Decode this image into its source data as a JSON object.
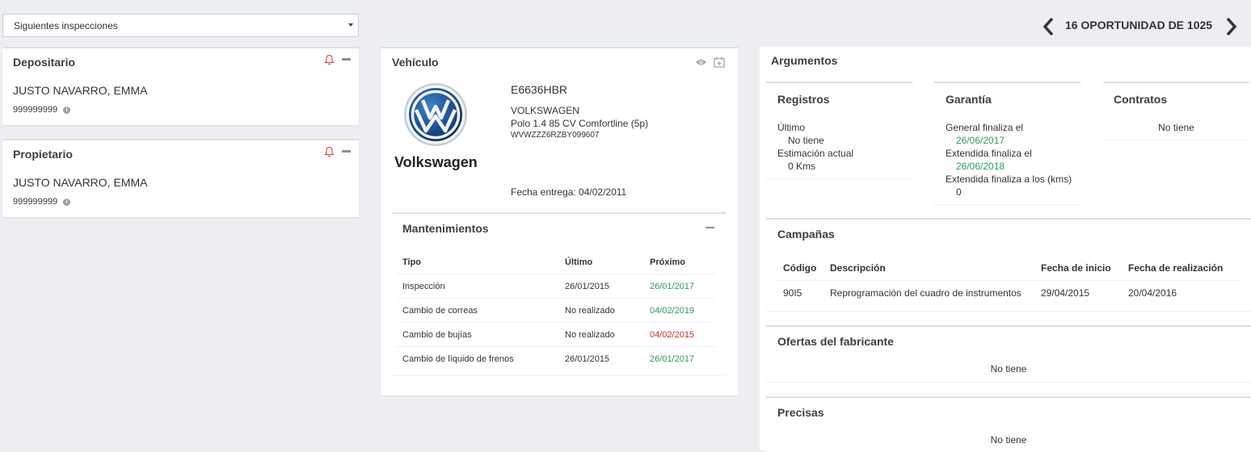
{
  "filter": {
    "selected": "Siguientes inspecciones"
  },
  "nav": {
    "counter": "16 OPORTUNIDAD DE 1025"
  },
  "depositario": {
    "title": "Depositario",
    "name": "JUSTO NAVARRO, EMMA",
    "phone": "999999999"
  },
  "propietario": {
    "title": "Propietario",
    "name": "JUSTO NAVARRO, EMMA",
    "phone": "999999999"
  },
  "vehiculo": {
    "title": "Vehículo",
    "brand_name": "Volkswagen",
    "plate": "E6636HBR",
    "make": "VOLKSWAGEN",
    "model": "Polo 1.4 85 CV Comfortline (5p)",
    "vin": "WVWZZZ6RZBY099607",
    "delivery": "Fecha entrega: 04/02/2011"
  },
  "mantenimientos": {
    "title": "Mantenimientos",
    "headers": [
      "Tipo",
      "Último",
      "Próximo"
    ],
    "rows": [
      {
        "tipo": "Inspección",
        "ultimo": "26/01/2015",
        "proximo": "26/01/2017",
        "status": "ok"
      },
      {
        "tipo": "Cambio de correas",
        "ultimo": "No realizado",
        "proximo": "04/02/2019",
        "status": "ok"
      },
      {
        "tipo": "Cambio de bujías",
        "ultimo": "No realizado",
        "proximo": "04/02/2015",
        "status": "overdue"
      },
      {
        "tipo": "Cambio de líquido de frenos",
        "ultimo": "26/01/2015",
        "proximo": "26/01/2017",
        "status": "ok"
      }
    ]
  },
  "argumentos": {
    "title": "Argumentos",
    "registros": {
      "title": "Registros",
      "ultimo_label": "Último",
      "ultimo_value": "No tiene",
      "estimacion_label": "Estimación actual",
      "estimacion_value": "0 Kms"
    },
    "garantia": {
      "title": "Garantía",
      "general_label": "General finaliza el",
      "general_value": "26/06/2017",
      "extendida_label": "Extendida finaliza el",
      "extendida_value": "26/06/2018",
      "kms_label": "Extendida finaliza a los (kms)",
      "kms_value": "0"
    },
    "contratos": {
      "title": "Contratos",
      "value": "No tiene"
    }
  },
  "campanas": {
    "title": "Campañas",
    "headers": [
      "Código",
      "Descripción",
      "Fecha de inicio",
      "Fecha de realización"
    ],
    "rows": [
      {
        "codigo": "90I5",
        "descripcion": "Reprogramación del cuadro de instrumentos",
        "inicio": "29/04/2015",
        "realizacion": "20/04/2016"
      }
    ]
  },
  "ofertas": {
    "title": "Ofertas del fabricante",
    "value": "No tiene"
  },
  "precisas": {
    "title": "Precisas",
    "value": "No tiene"
  },
  "colors": {
    "ok": "#2e9a5a",
    "overdue": "#c9302c",
    "bell": "#d9534f",
    "vw_blue": "#1f4e8c"
  }
}
